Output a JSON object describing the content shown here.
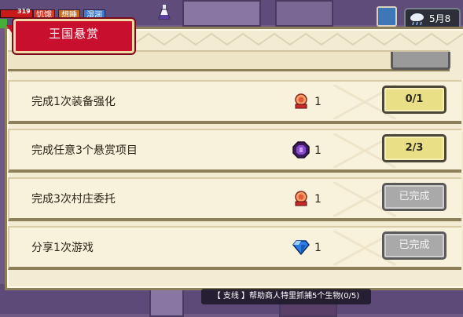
{
  "hud": {
    "hp_value": "319",
    "status_tags": [
      {
        "label": "饥饿",
        "color": "#d23a2a"
      },
      {
        "label": "想睡",
        "color": "#c56a1a"
      },
      {
        "label": "湿润",
        "color": "#3c7bd0"
      }
    ]
  },
  "date": {
    "label": "5月8日",
    "weather_icon": "rain-cloud-icon"
  },
  "panel": {
    "title": "王国悬赏",
    "tasks": [
      {
        "text": "完成1次装备强化",
        "reward_icon": "red-medal-icon",
        "reward_count": "1",
        "status": "0/1",
        "completed": false
      },
      {
        "text": "完成任意3个悬赏项目",
        "reward_icon": "purple-gem-icon",
        "reward_count": "1",
        "status": "2/3",
        "completed": false
      },
      {
        "text": "完成3次村庄委托",
        "reward_icon": "red-medal-icon",
        "reward_count": "1",
        "status": "已完成",
        "completed": true
      },
      {
        "text": "分享1次游戏",
        "reward_icon": "blue-diamond-icon",
        "reward_count": "1",
        "status": "已完成",
        "completed": true
      }
    ]
  },
  "quest_banner": {
    "text": "【 支线 】帮助商人特里抓捕5个生物(0/5)"
  },
  "colors": {
    "accent_red": "#c8102e",
    "progress_yellow": "#e8df86",
    "done_gray": "#a9a9a9",
    "panel_bg": "#f3ecd3"
  }
}
